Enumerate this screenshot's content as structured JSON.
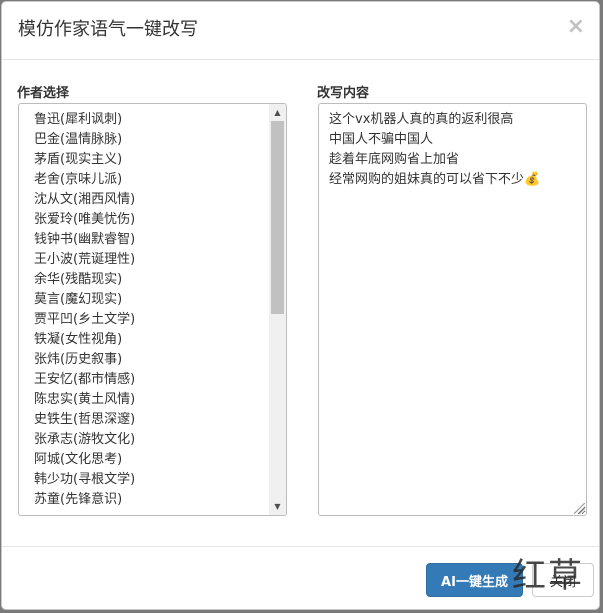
{
  "modal": {
    "title": "模仿作家语气一键改写",
    "close_symbol": "×"
  },
  "author_select": {
    "label": "作者选择",
    "items": [
      "鲁迅(犀利讽刺)",
      "巴金(温情脉脉)",
      "茅盾(现实主义)",
      "老舍(京味儿派)",
      "沈从文(湘西风情)",
      "张爱玲(唯美忧伤)",
      "钱钟书(幽默睿智)",
      "王小波(荒诞理性)",
      "余华(残酷现实)",
      "莫言(魔幻现实)",
      "贾平凹(乡土文学)",
      "铁凝(女性视角)",
      "张炜(历史叙事)",
      "王安忆(都市情感)",
      "陈忠实(黄土风情)",
      "史铁生(哲思深邃)",
      "张承志(游牧文化)",
      "阿城(文化思考)",
      "韩少功(寻根文学)",
      "苏童(先锋意识)"
    ]
  },
  "rewrite_content": {
    "label": "改写内容",
    "value": "这个vx机器人真的真的返利很高\n中国人不骗中国人\n趁着年底网购省上加省\n经常网购的姐妹真的可以省下不少💰"
  },
  "footer": {
    "generate_label": "AI一键生成",
    "close_label": "关闭"
  },
  "watermark": "红草",
  "colors": {
    "primary": "#337ab7",
    "backdrop": "#7a7a7a"
  }
}
